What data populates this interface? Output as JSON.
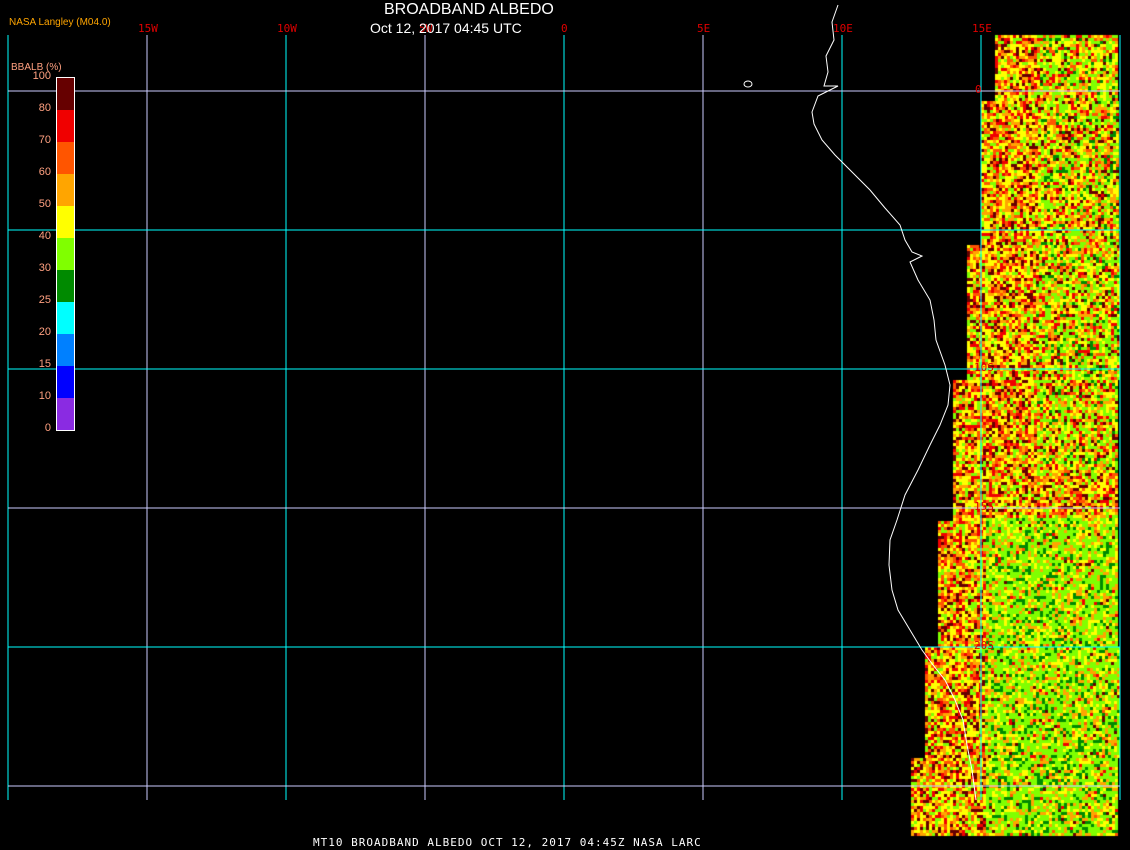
{
  "header": {
    "title": "BROADBAND ALBEDO",
    "datetime": "Oct 12, 2017 04:45 UTC",
    "credit": "NASA Langley (M04.0)"
  },
  "legend": {
    "title": "BBALB (%)",
    "ticks": [
      "100",
      "80",
      "70",
      "60",
      "50",
      "40",
      "30",
      "25",
      "20",
      "15",
      "10",
      "0"
    ],
    "colors": [
      "#660000",
      "#f00000",
      "#ff5500",
      "#ffa500",
      "#ffff00",
      "#80ff00",
      "#008a00",
      "#00ffff",
      "#0080ff",
      "#0000ff",
      "#8a2be2"
    ]
  },
  "longitude_labels": [
    "15W",
    "10W",
    "5W",
    "0",
    "5E",
    "10E",
    "15E"
  ],
  "latitude_labels": [
    "0",
    "10S",
    "15S",
    "20S"
  ],
  "footer": "MT10  BROADBAND ALBEDO   OCT 12, 2017 04:45Z   NASA LARC"
}
